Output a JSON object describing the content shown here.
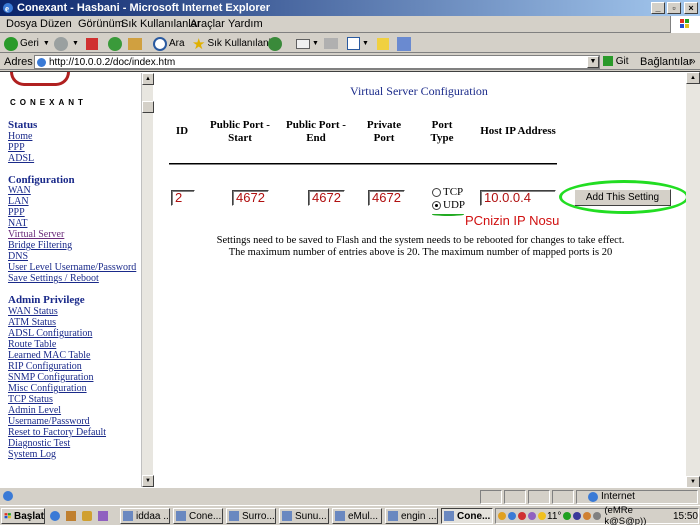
{
  "window": {
    "title": "Conexant - Hasbani - Microsoft Internet Explorer"
  },
  "menu": [
    "Dosya",
    "Düzen",
    "Görünüm",
    "Sık Kullanılanlar",
    "Araçlar",
    "Yardım"
  ],
  "toolbar": {
    "back": "Geri",
    "search": "Ara",
    "favorites": "Sık Kullanılanlar"
  },
  "address": {
    "label": "Adres",
    "url": "http://10.0.0.2/doc/index.htm",
    "go": "Git",
    "links": "Bağlantılar"
  },
  "sidebar": {
    "logo": "CONEXANT",
    "status": {
      "title": "Status",
      "items": [
        "Home",
        "PPP",
        "ADSL"
      ]
    },
    "configuration": {
      "title": "Configuration",
      "items": [
        "WAN",
        "LAN",
        "PPP",
        "NAT",
        "Virtual Server",
        "Bridge Filtering",
        "DNS",
        "User Level Username/Password",
        "Save Settings / Reboot"
      ]
    },
    "admin": {
      "title": "Admin Privilege",
      "items": [
        "WAN Status",
        "ATM Status",
        "ADSL Configuration",
        "Route Table",
        "Learned MAC Table",
        "RIP Configuration",
        "SNMP Configuration",
        "Misc Configuration",
        "TCP Status",
        "Admin Level",
        "Username/Password",
        "Reset to Factory Default",
        "Diagnostic Test",
        "System Log"
      ]
    }
  },
  "main": {
    "heading": "Virtual Server Configuration",
    "columns": {
      "id": "ID",
      "pub_start_1": "Public Port -",
      "pub_start_2": "Start",
      "pub_end_1": "Public Port -",
      "pub_end_2": "End",
      "private_1": "Private",
      "private_2": "Port",
      "port_type_1": "Port",
      "port_type_2": "Type",
      "host": "Host IP Address"
    },
    "row": {
      "id": "2",
      "public_start": "4672",
      "public_end": "4672",
      "private_port": "4672",
      "tcp": "TCP",
      "udp": "UDP",
      "selected": "UDP",
      "host_ip": "10.0.0.4"
    },
    "add_button": "Add This Setting",
    "annotation": "PCnizin IP Nosu",
    "note1": "Settings need to be saved to Flash and the system needs to be rebooted for changes to take effect.",
    "note2": "The maximum number of entries above is 20. The maximum number of mapped ports is 20"
  },
  "statusbar": {
    "zone": "Internet"
  },
  "taskbar": {
    "start": "Başlat",
    "tasks": [
      "iddaa ...",
      "Cone...",
      "Surro...",
      "Sunu...",
      "eMul...",
      "engin ...",
      "Cone..."
    ],
    "tray_temp": "11°",
    "tray_user": "(eMRe k@S@p))",
    "clock": "15:50"
  }
}
